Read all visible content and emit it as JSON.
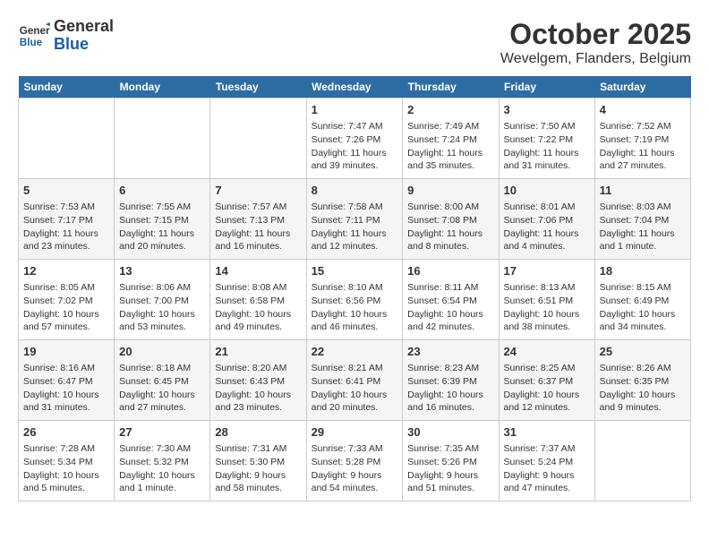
{
  "header": {
    "logo_general": "General",
    "logo_blue": "Blue",
    "month": "October 2025",
    "location": "Wevelgem, Flanders, Belgium"
  },
  "days_of_week": [
    "Sunday",
    "Monday",
    "Tuesday",
    "Wednesday",
    "Thursday",
    "Friday",
    "Saturday"
  ],
  "weeks": [
    [
      {
        "day": "",
        "data": ""
      },
      {
        "day": "",
        "data": ""
      },
      {
        "day": "",
        "data": ""
      },
      {
        "day": "1",
        "data": "Sunrise: 7:47 AM\nSunset: 7:26 PM\nDaylight: 11 hours and 39 minutes."
      },
      {
        "day": "2",
        "data": "Sunrise: 7:49 AM\nSunset: 7:24 PM\nDaylight: 11 hours and 35 minutes."
      },
      {
        "day": "3",
        "data": "Sunrise: 7:50 AM\nSunset: 7:22 PM\nDaylight: 11 hours and 31 minutes."
      },
      {
        "day": "4",
        "data": "Sunrise: 7:52 AM\nSunset: 7:19 PM\nDaylight: 11 hours and 27 minutes."
      }
    ],
    [
      {
        "day": "5",
        "data": "Sunrise: 7:53 AM\nSunset: 7:17 PM\nDaylight: 11 hours and 23 minutes."
      },
      {
        "day": "6",
        "data": "Sunrise: 7:55 AM\nSunset: 7:15 PM\nDaylight: 11 hours and 20 minutes."
      },
      {
        "day": "7",
        "data": "Sunrise: 7:57 AM\nSunset: 7:13 PM\nDaylight: 11 hours and 16 minutes."
      },
      {
        "day": "8",
        "data": "Sunrise: 7:58 AM\nSunset: 7:11 PM\nDaylight: 11 hours and 12 minutes."
      },
      {
        "day": "9",
        "data": "Sunrise: 8:00 AM\nSunset: 7:08 PM\nDaylight: 11 hours and 8 minutes."
      },
      {
        "day": "10",
        "data": "Sunrise: 8:01 AM\nSunset: 7:06 PM\nDaylight: 11 hours and 4 minutes."
      },
      {
        "day": "11",
        "data": "Sunrise: 8:03 AM\nSunset: 7:04 PM\nDaylight: 11 hours and 1 minute."
      }
    ],
    [
      {
        "day": "12",
        "data": "Sunrise: 8:05 AM\nSunset: 7:02 PM\nDaylight: 10 hours and 57 minutes."
      },
      {
        "day": "13",
        "data": "Sunrise: 8:06 AM\nSunset: 7:00 PM\nDaylight: 10 hours and 53 minutes."
      },
      {
        "day": "14",
        "data": "Sunrise: 8:08 AM\nSunset: 6:58 PM\nDaylight: 10 hours and 49 minutes."
      },
      {
        "day": "15",
        "data": "Sunrise: 8:10 AM\nSunset: 6:56 PM\nDaylight: 10 hours and 46 minutes."
      },
      {
        "day": "16",
        "data": "Sunrise: 8:11 AM\nSunset: 6:54 PM\nDaylight: 10 hours and 42 minutes."
      },
      {
        "day": "17",
        "data": "Sunrise: 8:13 AM\nSunset: 6:51 PM\nDaylight: 10 hours and 38 minutes."
      },
      {
        "day": "18",
        "data": "Sunrise: 8:15 AM\nSunset: 6:49 PM\nDaylight: 10 hours and 34 minutes."
      }
    ],
    [
      {
        "day": "19",
        "data": "Sunrise: 8:16 AM\nSunset: 6:47 PM\nDaylight: 10 hours and 31 minutes."
      },
      {
        "day": "20",
        "data": "Sunrise: 8:18 AM\nSunset: 6:45 PM\nDaylight: 10 hours and 27 minutes."
      },
      {
        "day": "21",
        "data": "Sunrise: 8:20 AM\nSunset: 6:43 PM\nDaylight: 10 hours and 23 minutes."
      },
      {
        "day": "22",
        "data": "Sunrise: 8:21 AM\nSunset: 6:41 PM\nDaylight: 10 hours and 20 minutes."
      },
      {
        "day": "23",
        "data": "Sunrise: 8:23 AM\nSunset: 6:39 PM\nDaylight: 10 hours and 16 minutes."
      },
      {
        "day": "24",
        "data": "Sunrise: 8:25 AM\nSunset: 6:37 PM\nDaylight: 10 hours and 12 minutes."
      },
      {
        "day": "25",
        "data": "Sunrise: 8:26 AM\nSunset: 6:35 PM\nDaylight: 10 hours and 9 minutes."
      }
    ],
    [
      {
        "day": "26",
        "data": "Sunrise: 7:28 AM\nSunset: 5:34 PM\nDaylight: 10 hours and 5 minutes."
      },
      {
        "day": "27",
        "data": "Sunrise: 7:30 AM\nSunset: 5:32 PM\nDaylight: 10 hours and 1 minute."
      },
      {
        "day": "28",
        "data": "Sunrise: 7:31 AM\nSunset: 5:30 PM\nDaylight: 9 hours and 58 minutes."
      },
      {
        "day": "29",
        "data": "Sunrise: 7:33 AM\nSunset: 5:28 PM\nDaylight: 9 hours and 54 minutes."
      },
      {
        "day": "30",
        "data": "Sunrise: 7:35 AM\nSunset: 5:26 PM\nDaylight: 9 hours and 51 minutes."
      },
      {
        "day": "31",
        "data": "Sunrise: 7:37 AM\nSunset: 5:24 PM\nDaylight: 9 hours and 47 minutes."
      },
      {
        "day": "",
        "data": ""
      }
    ]
  ]
}
